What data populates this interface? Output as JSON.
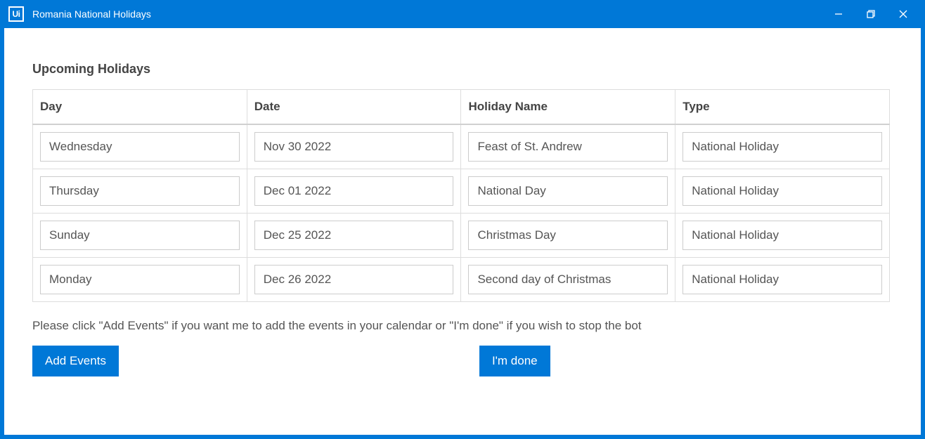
{
  "window": {
    "icon_text": "Ui",
    "title": "Romania National Holidays"
  },
  "main": {
    "heading": "Upcoming Holidays",
    "columns": {
      "day": "Day",
      "date": "Date",
      "name": "Holiday Name",
      "type": "Type"
    },
    "rows": [
      {
        "day": "Wednesday",
        "date": "Nov 30 2022",
        "name": "Feast of St. Andrew",
        "type": "National Holiday"
      },
      {
        "day": "Thursday",
        "date": "Dec 01 2022",
        "name": "National Day",
        "type": "National Holiday"
      },
      {
        "day": "Sunday",
        "date": "Dec 25 2022",
        "name": "Christmas Day",
        "type": "National Holiday"
      },
      {
        "day": "Monday",
        "date": "Dec 26 2022",
        "name": "Second day of Christmas",
        "type": "National Holiday"
      }
    ],
    "instruction": "Please click \"Add Events\" if you want me to add the events in your calendar or \"I'm done\" if you wish to stop the bot",
    "buttons": {
      "add_events": "Add Events",
      "done": "I'm done"
    }
  }
}
